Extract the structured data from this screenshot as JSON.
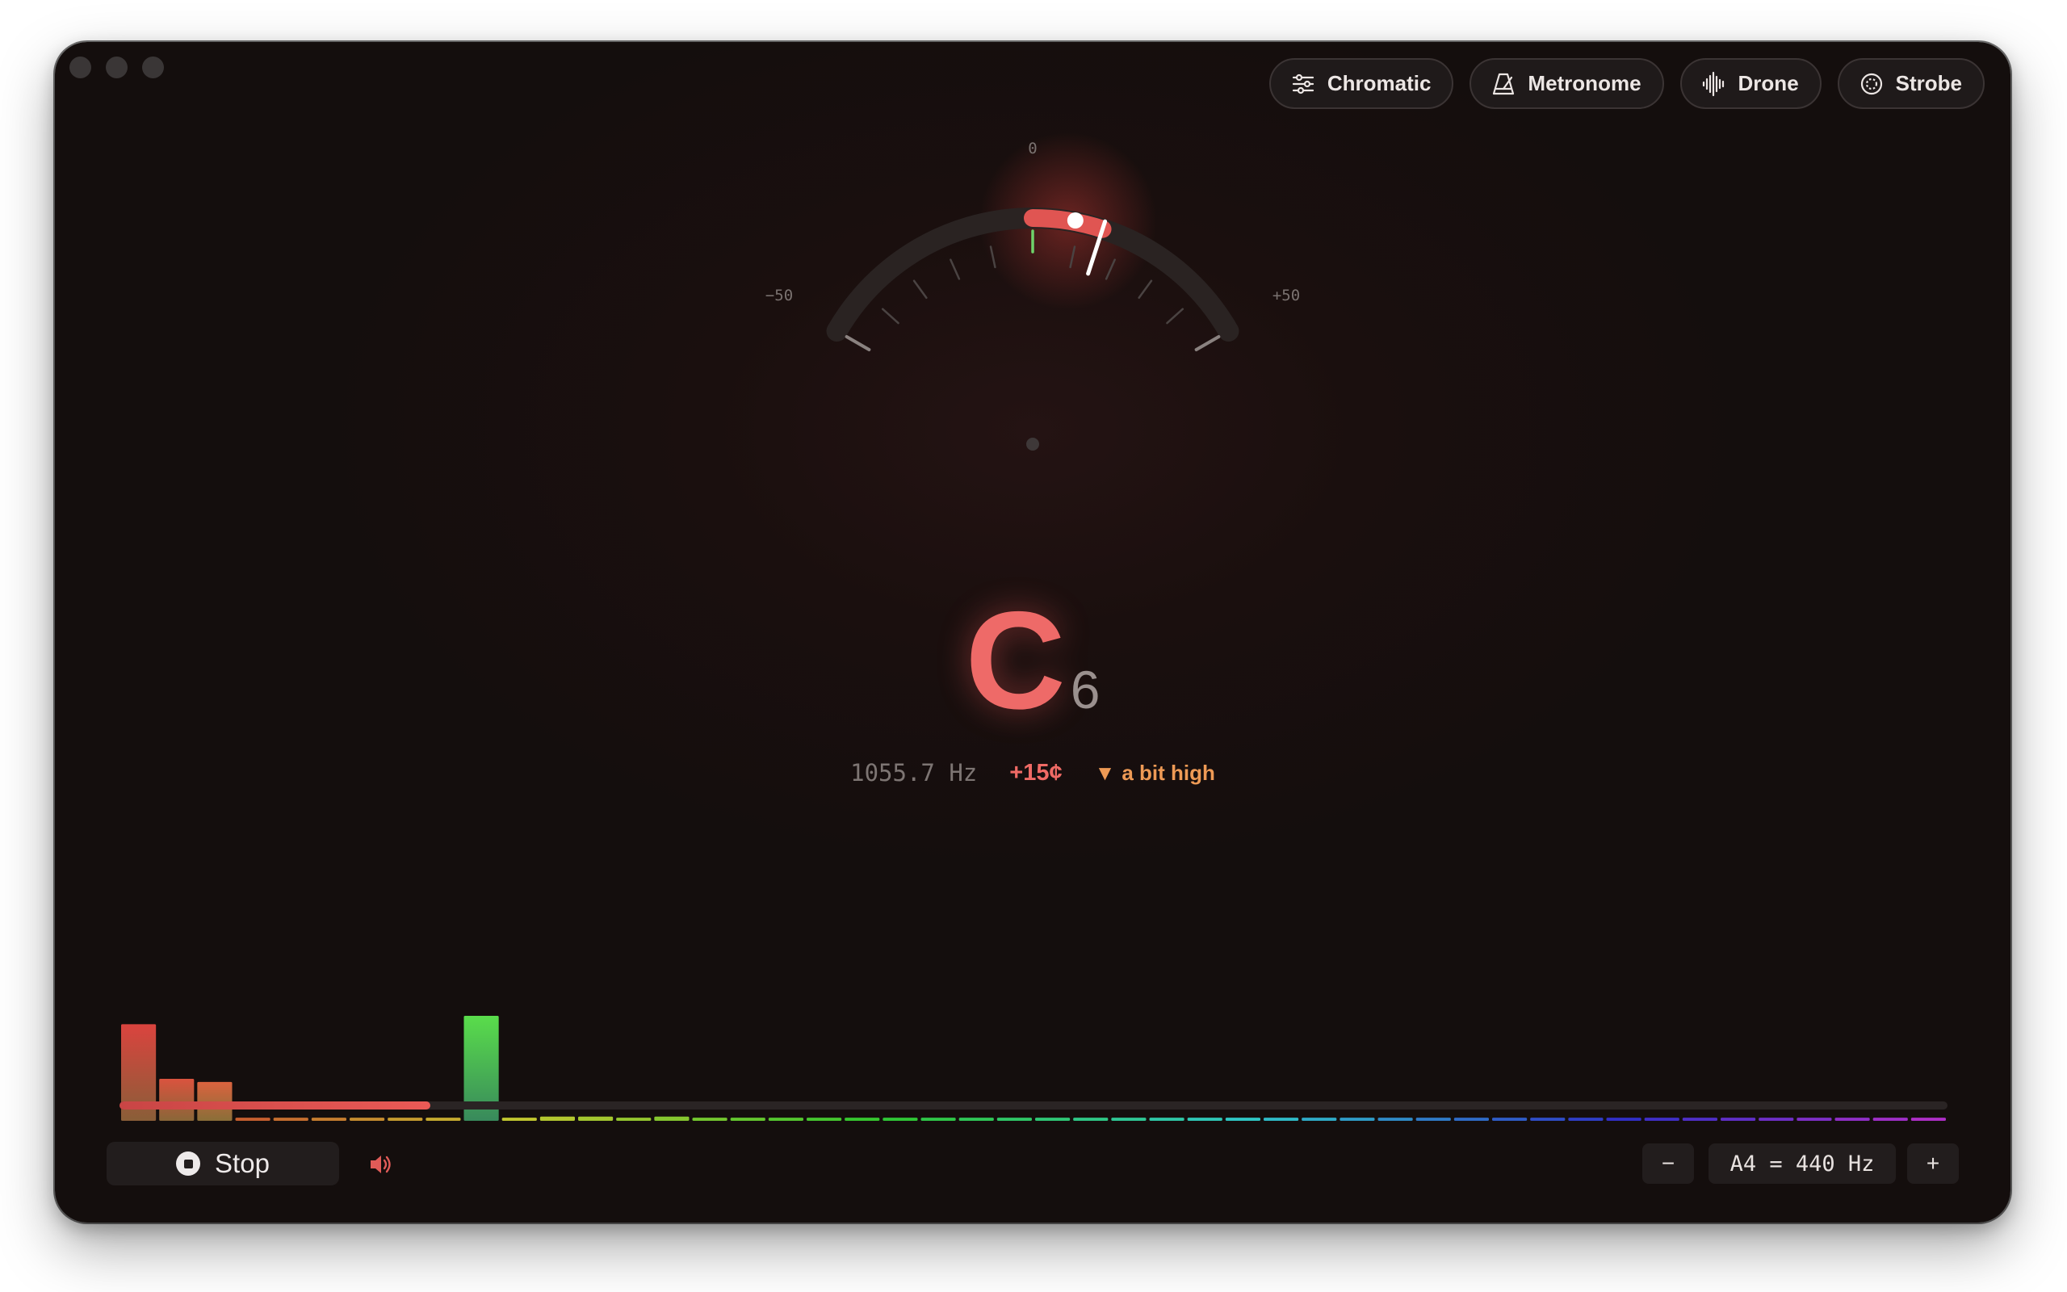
{
  "window": {
    "traffic_lights": [
      "close",
      "minimize",
      "zoom"
    ]
  },
  "toolbar": {
    "buttons": [
      {
        "label": "Chromatic",
        "icon": "sliders-icon"
      },
      {
        "label": "Metronome",
        "icon": "metronome-icon"
      },
      {
        "label": "Drone",
        "icon": "waveform-icon"
      },
      {
        "label": "Strobe",
        "icon": "strobe-circle-icon"
      }
    ]
  },
  "gauge": {
    "min_label": "−50",
    "center_label": "0",
    "max_label": "+50",
    "range_cents": [
      -50,
      50
    ],
    "needle_cents": 15,
    "colors": {
      "arc": "#2a2322",
      "highlight": "#e05552",
      "in_tune": "#6fd36a",
      "needle": "#ffffff"
    }
  },
  "note": {
    "letter": "C",
    "octave": "6",
    "color": "#ee6a68"
  },
  "readout": {
    "frequency": "1055.7 Hz",
    "cents": "+15¢",
    "hint_arrow": "▼",
    "hint_text": "a bit high"
  },
  "spectrum": {
    "levels": [
      0.92,
      0.4,
      0.37,
      0.03,
      0.03,
      0.03,
      0.03,
      0.03,
      0.03,
      1.0,
      0.03,
      0.04,
      0.04,
      0.03,
      0.04,
      0.03,
      0.03,
      0.03,
      0.03,
      0.03,
      0.03,
      0.03,
      0.03,
      0.03,
      0.03,
      0.03,
      0.03,
      0.03,
      0.03,
      0.03,
      0.03,
      0.03,
      0.03,
      0.03,
      0.03,
      0.03,
      0.03,
      0.03,
      0.03,
      0.03,
      0.03,
      0.03,
      0.03,
      0.03,
      0.03,
      0.03,
      0.03,
      0.03
    ]
  },
  "progress": {
    "value": 0.17
  },
  "controls": {
    "stop_label": "Stop",
    "volume_icon": "speaker-icon",
    "minus_label": "−",
    "reference": "A4 = 440 Hz",
    "plus_label": "+"
  }
}
